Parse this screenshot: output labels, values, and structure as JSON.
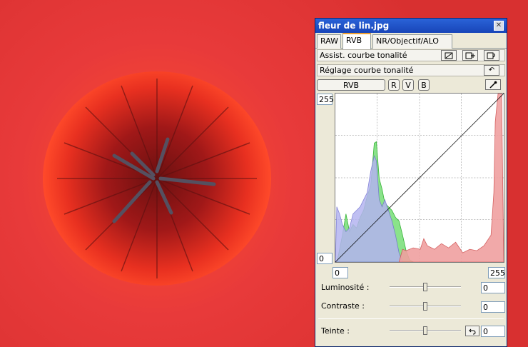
{
  "window": {
    "title": "fleur de lin.jpg",
    "close_symbol": "✕"
  },
  "tabs": [
    {
      "label": "RAW",
      "active": false
    },
    {
      "label": "RVB",
      "active": true
    },
    {
      "label": "NR/Objectif/ALO",
      "active": false
    }
  ],
  "tone_assist": {
    "label": "Assist. courbe tonalité"
  },
  "tone_curve": {
    "label": "Réglage courbe tonalité",
    "reset_symbol": "↶"
  },
  "channels": {
    "rvb": "RVB",
    "r": "R",
    "v": "V",
    "b": "B"
  },
  "histogram": {
    "top_value": "255",
    "bottom_value": "0",
    "input_min": "0",
    "input_max": "255"
  },
  "adjustments": {
    "luminosite": {
      "label": "Luminosité :",
      "value": "0"
    },
    "contraste": {
      "label": "Contraste :",
      "value": "0"
    },
    "teinte": {
      "label": "Teinte :",
      "value": "0"
    }
  },
  "colors": {
    "photo_red": "#e83c3c",
    "histogram_blue": "#b4b4f0",
    "histogram_green": "#7ee07e",
    "histogram_red": "#f0a0a0",
    "title_bar": "#1f55cc"
  }
}
